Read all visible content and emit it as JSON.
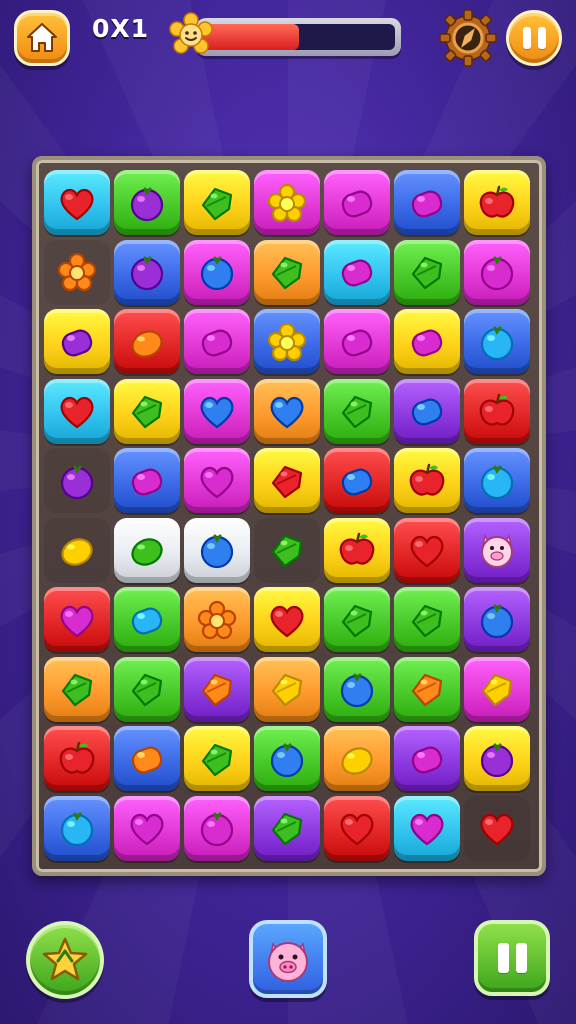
{
  "hud": {
    "score_text": "0X1",
    "progress_fraction": 0.5,
    "icons": {
      "home": "home-icon",
      "flower": "flower-icon",
      "gear": "gear-icon",
      "pause": "pause-icon",
      "star": "star-icon",
      "pig": "pig-icon"
    }
  },
  "colors": {
    "background": "#3f2496",
    "progress_fill": "#e0302a",
    "tile_cyan": "#33c3f0",
    "tile_green": "#49c92a",
    "tile_yellow": "#ffd21a",
    "tile_magenta": "#e33ad6",
    "tile_blue": "#3d6be8",
    "tile_orange": "#ff9a2e",
    "tile_red": "#e32727",
    "tile_purple": "#8d3be0",
    "tile_pink": "#ff6fb5"
  },
  "board": {
    "rows": 10,
    "cols": 7,
    "cells": [
      [
        [
          "cyan",
          "heart",
          "red"
        ],
        [
          "green",
          "berry",
          "purple"
        ],
        [
          "yellow",
          "leaf",
          "green"
        ],
        [
          "magenta",
          "flower",
          "yellow"
        ],
        [
          "magenta",
          "candy",
          "magenta"
        ],
        [
          "blue",
          "candy",
          "magenta"
        ],
        [
          "yellow",
          "apple",
          "red"
        ]
      ],
      [
        [
          "empty",
          "flower",
          "orange"
        ],
        [
          "blue",
          "berry",
          "purple"
        ],
        [
          "magenta",
          "berry",
          "blue"
        ],
        [
          "orange",
          "leaf",
          "green"
        ],
        [
          "cyan",
          "candy",
          "magenta"
        ],
        [
          "green",
          "leaf",
          "green"
        ],
        [
          "magenta",
          "berry",
          "magenta"
        ]
      ],
      [
        [
          "yellow",
          "candy",
          "purple"
        ],
        [
          "red",
          "lemon",
          "orange"
        ],
        [
          "magenta",
          "candy",
          "magenta"
        ],
        [
          "blue",
          "flower",
          "yellow"
        ],
        [
          "magenta",
          "candy",
          "magenta"
        ],
        [
          "yellow",
          "candy",
          "magenta"
        ],
        [
          "blue",
          "berry",
          "cyan"
        ]
      ],
      [
        [
          "cyan",
          "heart",
          "red"
        ],
        [
          "yellow",
          "leaf",
          "green"
        ],
        [
          "magenta",
          "heart",
          "blue"
        ],
        [
          "orange",
          "heart",
          "blue"
        ],
        [
          "green",
          "leaf",
          "green"
        ],
        [
          "purple",
          "candy",
          "blue"
        ],
        [
          "red",
          "apple",
          "red"
        ]
      ],
      [
        [
          "empty",
          "berry",
          "purple"
        ],
        [
          "blue",
          "candy",
          "magenta"
        ],
        [
          "magenta",
          "heart",
          "magenta"
        ],
        [
          "yellow",
          "leaf",
          "red"
        ],
        [
          "red",
          "candy",
          "blue"
        ],
        [
          "yellow",
          "apple",
          "red"
        ],
        [
          "blue",
          "berry",
          "cyan"
        ]
      ],
      [
        [
          "empty",
          "lemon",
          "yellow"
        ],
        [
          "white",
          "lemon",
          "green"
        ],
        [
          "white",
          "berry",
          "blue"
        ],
        [
          "empty",
          "leaf",
          "green"
        ],
        [
          "yellow",
          "apple",
          "red"
        ],
        [
          "red",
          "heart",
          "red"
        ],
        [
          "purple",
          "pig",
          "pink"
        ]
      ],
      [
        [
          "red",
          "heart",
          "magenta"
        ],
        [
          "green",
          "candy",
          "cyan"
        ],
        [
          "orange",
          "flower",
          "orange"
        ],
        [
          "yellow",
          "heart",
          "red"
        ],
        [
          "green",
          "leaf",
          "green"
        ],
        [
          "green",
          "leaf",
          "green"
        ],
        [
          "purple",
          "berry",
          "blue"
        ]
      ],
      [
        [
          "orange",
          "leaf",
          "green"
        ],
        [
          "green",
          "leaf",
          "green"
        ],
        [
          "purple",
          "leaf",
          "orange"
        ],
        [
          "orange",
          "leaf",
          "yellow"
        ],
        [
          "green",
          "berry",
          "blue"
        ],
        [
          "green",
          "leaf",
          "orange"
        ],
        [
          "magenta",
          "leaf",
          "yellow"
        ]
      ],
      [
        [
          "red",
          "apple",
          "red"
        ],
        [
          "blue",
          "candy",
          "orange"
        ],
        [
          "yellow",
          "leaf",
          "green"
        ],
        [
          "green",
          "berry",
          "blue"
        ],
        [
          "orange",
          "lemon",
          "yellow"
        ],
        [
          "purple",
          "candy",
          "magenta"
        ],
        [
          "yellow",
          "berry",
          "purple"
        ]
      ],
      [
        [
          "blue",
          "berry",
          "cyan"
        ],
        [
          "magenta",
          "heart",
          "magenta"
        ],
        [
          "magenta",
          "berry",
          "magenta"
        ],
        [
          "purple",
          "leaf",
          "green"
        ],
        [
          "red",
          "heart",
          "red"
        ],
        [
          "cyan",
          "heart",
          "magenta"
        ],
        [
          "empty",
          "heart",
          "red"
        ]
      ]
    ]
  }
}
